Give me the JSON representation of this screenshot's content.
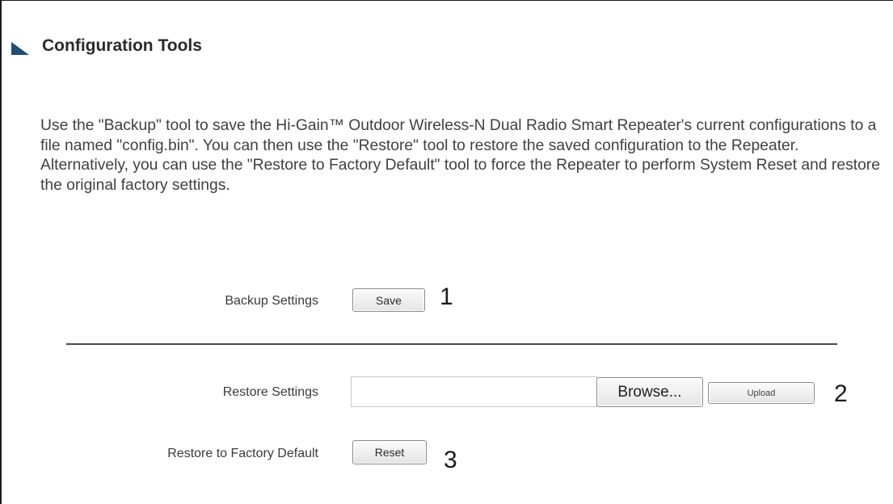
{
  "page": {
    "title": "Configuration Tools",
    "description": "Use the \"Backup\" tool to save the Hi-Gain™ Outdoor Wireless-N Dual Radio Smart Repeater's current configurations to a file named \"config.bin\". You can then use the \"Restore\" tool to restore the saved configuration to the Repeater. Alternatively, you can use the \"Restore to Factory Default\" tool to force the Repeater to perform System Reset and restore the original factory settings."
  },
  "backup": {
    "label": "Backup Settings",
    "button": "Save",
    "step": "1"
  },
  "restore": {
    "label": "Restore Settings",
    "file_value": "",
    "browse_button": "Browse...",
    "upload_button": "Upload",
    "step": "2"
  },
  "factory": {
    "label": "Restore to Factory Default",
    "button": "Reset",
    "step": "3"
  },
  "colors": {
    "title_marker": "#1f4e73",
    "divider": "#4a4a4a"
  }
}
